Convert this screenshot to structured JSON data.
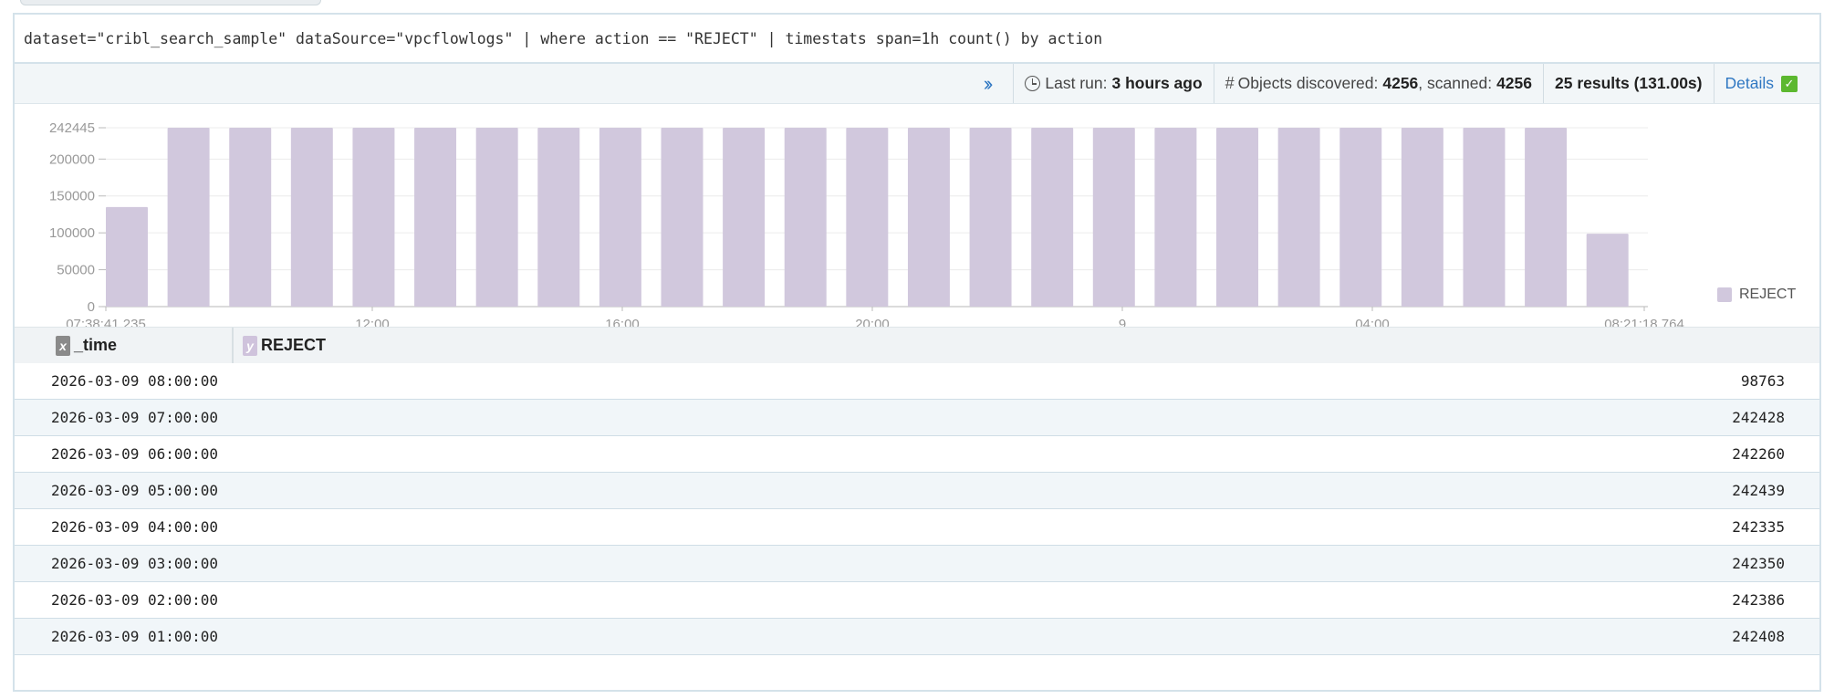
{
  "query": {
    "text": "dataset=\"cribl_search_sample\" dataSource=\"vpcflowlogs\" | where action == \"REJECT\" | timestats span=1h count() by action"
  },
  "status": {
    "last_run_label": "Last run:",
    "last_run_value": "3 hours ago",
    "objects_label": "Objects discovered:",
    "objects_discovered": "4256",
    "scanned_label": "scanned:",
    "objects_scanned": "4256",
    "results": "25 results (131.00s)",
    "details_label": "Details"
  },
  "chart_data": {
    "type": "bar",
    "series": [
      {
        "name": "REJECT",
        "values": [
          135000,
          242445,
          242445,
          242445,
          242445,
          242445,
          242445,
          242445,
          242445,
          242445,
          242445,
          242445,
          242445,
          242445,
          242445,
          242445,
          242445,
          242445,
          242445,
          242445,
          242445,
          242445,
          242445,
          242445,
          98763
        ]
      }
    ],
    "y_ticks": [
      "242445",
      "200000",
      "150000",
      "100000",
      "50000",
      "0"
    ],
    "y_tick_values": [
      242445,
      200000,
      150000,
      100000,
      50000,
      0
    ],
    "x_tick_labels": [
      "07:38:41 235",
      "12:00",
      "16:00",
      "20:00",
      "9",
      "04:00",
      "08:21:18 764"
    ],
    "ylim": [
      0,
      242445
    ],
    "color": "#d1c8dd",
    "grid": true,
    "legend": "right"
  },
  "table": {
    "columns": [
      {
        "badge": "x",
        "name": "_time"
      },
      {
        "badge": "y",
        "name": "REJECT"
      }
    ],
    "rows": [
      {
        "time": "2026-03-09 08:00:00",
        "value": "98763"
      },
      {
        "time": "2026-03-09 07:00:00",
        "value": "242428"
      },
      {
        "time": "2026-03-09 06:00:00",
        "value": "242260"
      },
      {
        "time": "2026-03-09 05:00:00",
        "value": "242439"
      },
      {
        "time": "2026-03-09 04:00:00",
        "value": "242335"
      },
      {
        "time": "2026-03-09 03:00:00",
        "value": "242350"
      },
      {
        "time": "2026-03-09 02:00:00",
        "value": "242386"
      },
      {
        "time": "2026-03-09 01:00:00",
        "value": "242408"
      }
    ]
  }
}
